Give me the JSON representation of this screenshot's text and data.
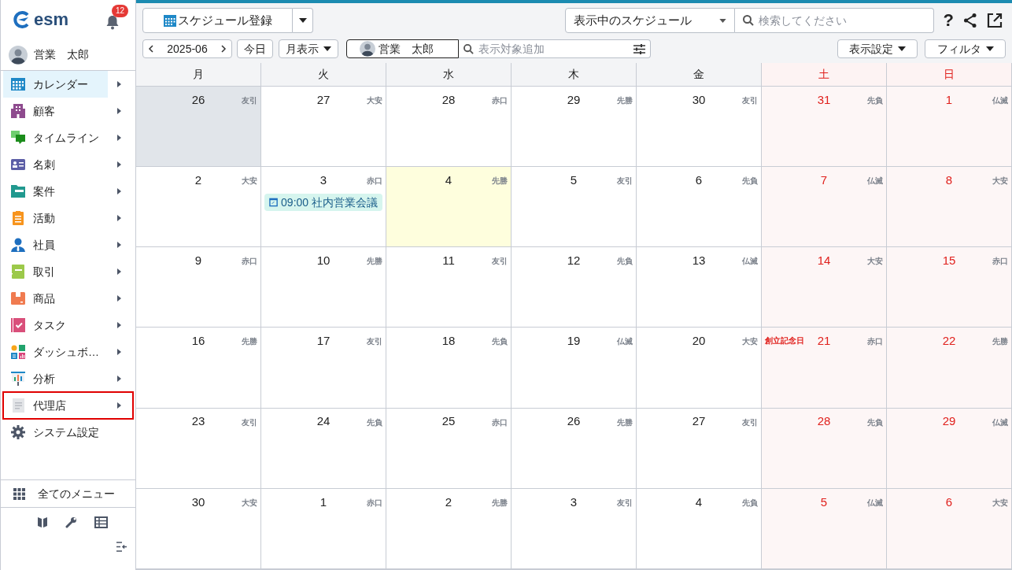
{
  "app": {
    "logo": "esm",
    "notification_count": "12"
  },
  "user": {
    "name": "営業　太郎"
  },
  "sidebar": {
    "items": [
      {
        "label": "カレンダー",
        "selected": true,
        "has_submenu": true,
        "highlighted": false
      },
      {
        "label": "顧客",
        "selected": false,
        "has_submenu": true,
        "highlighted": false
      },
      {
        "label": "タイムライン",
        "selected": false,
        "has_submenu": true,
        "highlighted": false
      },
      {
        "label": "名刺",
        "selected": false,
        "has_submenu": true,
        "highlighted": false
      },
      {
        "label": "案件",
        "selected": false,
        "has_submenu": true,
        "highlighted": false
      },
      {
        "label": "活動",
        "selected": false,
        "has_submenu": true,
        "highlighted": false
      },
      {
        "label": "社員",
        "selected": false,
        "has_submenu": true,
        "highlighted": false
      },
      {
        "label": "取引",
        "selected": false,
        "has_submenu": true,
        "highlighted": false
      },
      {
        "label": "商品",
        "selected": false,
        "has_submenu": true,
        "highlighted": false
      },
      {
        "label": "タスク",
        "selected": false,
        "has_submenu": true,
        "highlighted": false
      },
      {
        "label": "ダッシュボ…",
        "selected": false,
        "has_submenu": true,
        "highlighted": false
      },
      {
        "label": "分析",
        "selected": false,
        "has_submenu": true,
        "highlighted": false
      },
      {
        "label": "代理店",
        "selected": false,
        "has_submenu": true,
        "highlighted": true
      },
      {
        "label": "システム設定",
        "selected": false,
        "has_submenu": false,
        "highlighted": false
      }
    ],
    "all_menu": "全てのメニュー"
  },
  "toolbar": {
    "register_button": "スケジュール登録",
    "view_select": "表示中のスケジュール",
    "search": {
      "placeholder": "検索してください"
    },
    "help": "?",
    "month": "2025-06",
    "today_button": "今日",
    "view_mode": "月表示",
    "user_chip": "営業　太郎",
    "target_search": {
      "placeholder": "表示対象追加"
    },
    "display_settings": "表示設定",
    "filter": "フィルタ"
  },
  "calendar": {
    "weekdays": [
      {
        "label": "月",
        "kind": "weekday"
      },
      {
        "label": "火",
        "kind": "weekday"
      },
      {
        "label": "水",
        "kind": "weekday"
      },
      {
        "label": "木",
        "kind": "weekday"
      },
      {
        "label": "金",
        "kind": "weekday"
      },
      {
        "label": "土",
        "kind": "weekend"
      },
      {
        "label": "日",
        "kind": "weekend"
      }
    ],
    "weeks": [
      [
        {
          "date": "26",
          "rokuyo": "友引",
          "shaded": true
        },
        {
          "date": "27",
          "rokuyo": "大安"
        },
        {
          "date": "28",
          "rokuyo": "赤口"
        },
        {
          "date": "29",
          "rokuyo": "先勝"
        },
        {
          "date": "30",
          "rokuyo": "友引"
        },
        {
          "date": "31",
          "rokuyo": "先負"
        },
        {
          "date": "1",
          "rokuyo": "仏滅"
        }
      ],
      [
        {
          "date": "2",
          "rokuyo": "大安"
        },
        {
          "date": "3",
          "rokuyo": "赤口",
          "events": [
            {
              "time": "09:00",
              "title": "社内営業会議"
            }
          ]
        },
        {
          "date": "4",
          "rokuyo": "先勝",
          "today": true
        },
        {
          "date": "5",
          "rokuyo": "友引"
        },
        {
          "date": "6",
          "rokuyo": "先負"
        },
        {
          "date": "7",
          "rokuyo": "仏滅"
        },
        {
          "date": "8",
          "rokuyo": "大安"
        }
      ],
      [
        {
          "date": "9",
          "rokuyo": "赤口"
        },
        {
          "date": "10",
          "rokuyo": "先勝"
        },
        {
          "date": "11",
          "rokuyo": "友引"
        },
        {
          "date": "12",
          "rokuyo": "先負"
        },
        {
          "date": "13",
          "rokuyo": "仏滅"
        },
        {
          "date": "14",
          "rokuyo": "大安"
        },
        {
          "date": "15",
          "rokuyo": "赤口"
        }
      ],
      [
        {
          "date": "16",
          "rokuyo": "先勝"
        },
        {
          "date": "17",
          "rokuyo": "友引"
        },
        {
          "date": "18",
          "rokuyo": "先負"
        },
        {
          "date": "19",
          "rokuyo": "仏滅"
        },
        {
          "date": "20",
          "rokuyo": "大安"
        },
        {
          "date": "21",
          "rokuyo": "赤口",
          "holiday": "創立記念日"
        },
        {
          "date": "22",
          "rokuyo": "先勝"
        }
      ],
      [
        {
          "date": "23",
          "rokuyo": "友引"
        },
        {
          "date": "24",
          "rokuyo": "先負"
        },
        {
          "date": "25",
          "rokuyo": "赤口"
        },
        {
          "date": "26",
          "rokuyo": "先勝"
        },
        {
          "date": "27",
          "rokuyo": "友引"
        },
        {
          "date": "28",
          "rokuyo": "先負"
        },
        {
          "date": "29",
          "rokuyo": "仏滅"
        }
      ],
      [
        {
          "date": "30",
          "rokuyo": "大安"
        },
        {
          "date": "1",
          "rokuyo": "赤口"
        },
        {
          "date": "2",
          "rokuyo": "先勝"
        },
        {
          "date": "3",
          "rokuyo": "友引"
        },
        {
          "date": "4",
          "rokuyo": "先負"
        },
        {
          "date": "5",
          "rokuyo": "仏滅"
        },
        {
          "date": "6",
          "rokuyo": "大安"
        }
      ]
    ]
  }
}
